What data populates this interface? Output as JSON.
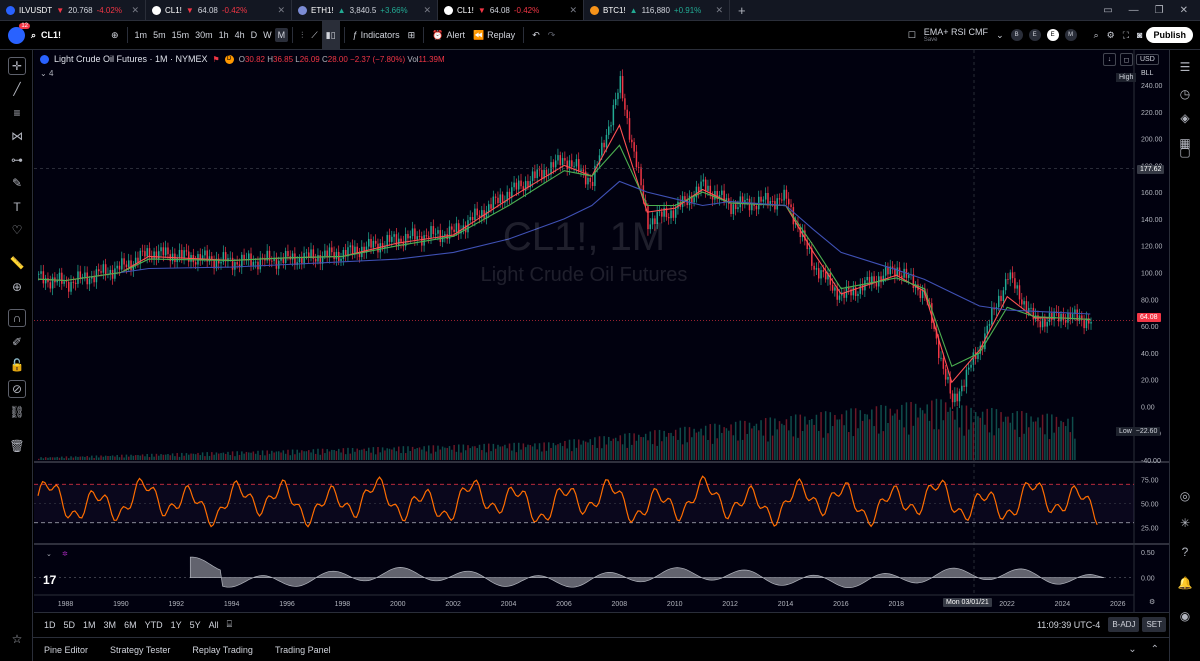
{
  "tabs": [
    {
      "icon_color": "#2962ff",
      "symbol": "ILVUSDT",
      "arrow": "▼",
      "price": "20.768",
      "change": "-4.02%",
      "dir": "neg",
      "active": false
    },
    {
      "icon_color": "#ffffff",
      "symbol": "CL1!",
      "arrow": "▼",
      "price": "64.08",
      "change": "-0.42%",
      "dir": "neg",
      "active": false
    },
    {
      "icon_color": "#7b8bd4",
      "symbol": "ETH1!",
      "arrow": "▲",
      "price": "3,840.5",
      "change": "+3.66%",
      "dir": "pos",
      "active": false
    },
    {
      "icon_color": "#ffffff",
      "symbol": "CL1!",
      "arrow": "▼",
      "price": "64.08",
      "change": "-0.42%",
      "dir": "neg",
      "active": true
    },
    {
      "icon_color": "#f7931a",
      "symbol": "BTC1!",
      "arrow": "▲",
      "price": "116,880",
      "change": "+0.91%",
      "dir": "pos",
      "active": false
    }
  ],
  "toolbar": {
    "notifications": "12",
    "symbol": "CL1!",
    "intervals": [
      "1m",
      "5m",
      "15m",
      "30m",
      "1h",
      "4h",
      "D",
      "W",
      "M"
    ],
    "active_interval": "M",
    "indicators_label": "Indicators",
    "alert_label": "Alert",
    "replay_label": "Replay",
    "layout_name": "EMA+ RSI CMF",
    "layout_sub": "Save",
    "publish_label": "Publish",
    "circle_buttons": [
      "B",
      "E",
      "E",
      "M"
    ]
  },
  "legend": {
    "title": "Light Crude Oil Futures · 1M · NYMEX",
    "o_label": "O",
    "o": "30.82",
    "h_label": "H",
    "h": "36.85",
    "l_label": "L",
    "l": "26.09",
    "c_label": "C",
    "c": "28.00",
    "change": "−2.37 (−7.80%)",
    "vol_label": "Vol",
    "vol": "11.39M",
    "sub": "4"
  },
  "watermark": {
    "line1": "CL1!, 1M",
    "line2": "Light Crude Oil Futures"
  },
  "price_axis": {
    "currency": "USD",
    "scale_mode": "BLL",
    "high_label": "High",
    "low_label": "Low",
    "low_value": "−22.60",
    "crosshair_price": "177.62",
    "last_price": "64.08",
    "last_price_color": "#f23645"
  },
  "rsi": {
    "upper": 70,
    "mid": 50,
    "lower": 30,
    "labels": [
      "75.00",
      "50.00",
      "25.00"
    ],
    "color": "#ff6d00"
  },
  "cmf": {
    "labels": [
      "0.50",
      "0.00"
    ],
    "color": "#b2b5be"
  },
  "time_axis": {
    "labels": [
      "1988",
      "1990",
      "1992",
      "1994",
      "1996",
      "1998",
      "2000",
      "2002",
      "2004",
      "2006",
      "2008",
      "2010",
      "2012",
      "2014",
      "2016",
      "2018",
      "2020",
      "2022",
      "2024",
      "2026"
    ],
    "crosshair": "Mon 03/01/21"
  },
  "bottom": {
    "ranges": [
      "1D",
      "5D",
      "1M",
      "3M",
      "6M",
      "YTD",
      "1Y",
      "5Y",
      "All"
    ],
    "clock": "11:09:39 UTC-4",
    "adj": "B-ADJ",
    "set": "SET"
  },
  "footer": {
    "tabs": [
      "Pine Editor",
      "Strategy Tester",
      "Replay Trading",
      "Trading Panel"
    ]
  },
  "chart_data": {
    "type": "line",
    "title": "Light Crude Oil Futures · 1M · NYMEX",
    "xlabel": "",
    "ylabel": "",
    "x": [
      1987,
      1988,
      1990,
      1991,
      1994,
      1996,
      1998,
      2000,
      2002,
      2004,
      2006,
      2007,
      2008,
      2009,
      2010,
      2011,
      2012,
      2014,
      2015,
      2016,
      2018,
      2019,
      2020,
      2021,
      2022,
      2023,
      2024,
      2025
    ],
    "ylim": [
      -40,
      240
    ],
    "series": [
      {
        "values": [
          96,
          92,
          104,
          115,
          108,
          110,
          114,
          125,
          130,
          160,
          185,
          168,
          240,
          138,
          147,
          165,
          150,
          155,
          105,
          82,
          103,
          84,
          2,
          45,
          98,
          63,
          68,
          64
        ]
      },
      {
        "values": [
          95,
          94,
          100,
          112,
          109,
          111,
          112,
          122,
          128,
          155,
          180,
          172,
          210,
          145,
          148,
          162,
          152,
          150,
          115,
          84,
          98,
          86,
          18,
          42,
          82,
          66,
          66,
          65
        ]
      },
      {
        "values": [
          95,
          94,
          100,
          110,
          109,
          111,
          112,
          120,
          127,
          150,
          176,
          172,
          195,
          150,
          150,
          160,
          152,
          150,
          120,
          88,
          96,
          88,
          30,
          40,
          74,
          67,
          66,
          65
        ]
      },
      {
        "values": [
          null,
          null,
          100,
          103,
          104,
          106,
          108,
          110,
          115,
          125,
          140,
          150,
          168,
          160,
          155,
          150,
          153,
          150,
          132,
          115,
          102,
          95,
          85,
          75,
          72,
          71,
          70,
          69
        ]
      }
    ],
    "series_colors": [
      "#f23645",
      "#ff5252",
      "#4caf50",
      "#3f51b5"
    ]
  }
}
